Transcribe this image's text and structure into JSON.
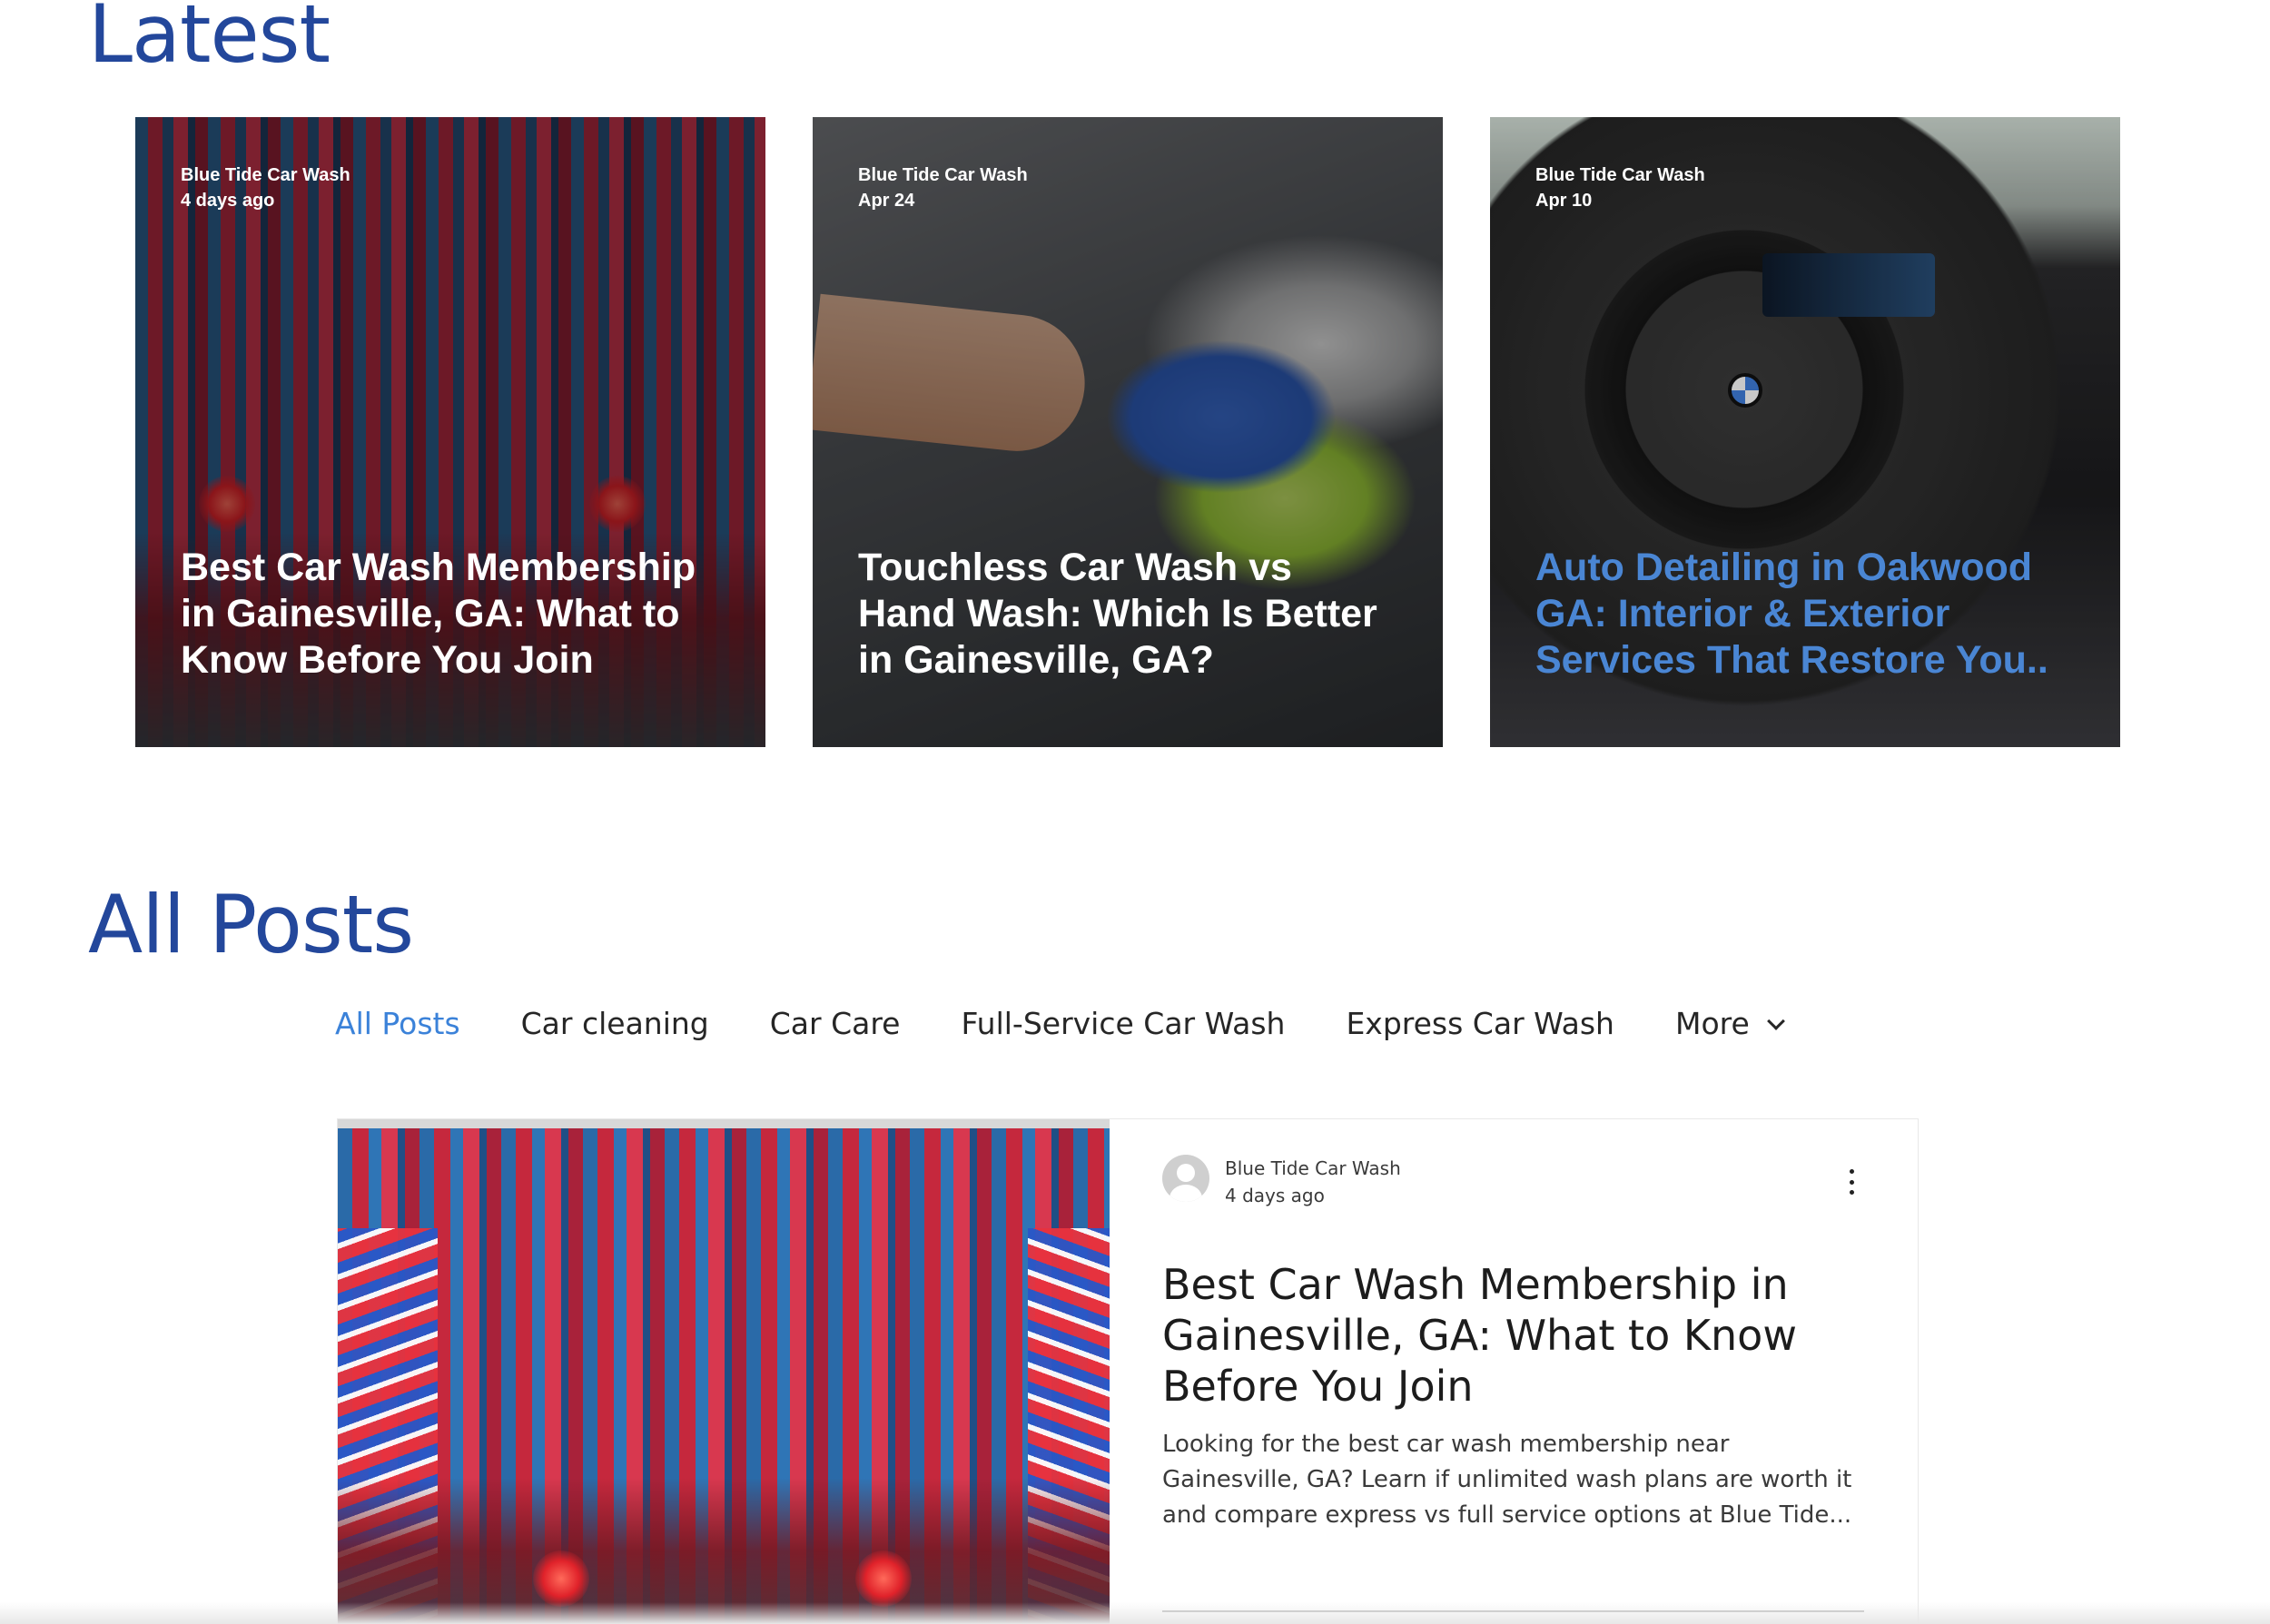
{
  "latest": {
    "heading": "Latest",
    "cards": [
      {
        "author": "Blue Tide Car Wash",
        "date": "4 days ago",
        "title": "Best Car Wash Membership in Gainesville, GA: What to Know Before You Join"
      },
      {
        "author": "Blue Tide Car Wash",
        "date": "Apr 24",
        "title": "Touchless Car Wash vs Hand Wash: Which Is Better in Gainesville, GA?"
      },
      {
        "author": "Blue Tide Car Wash",
        "date": "Apr 10",
        "title": "Auto Detailing in Oakwood GA: Interior & Exterior Services That Restore You.."
      }
    ]
  },
  "all_posts": {
    "heading": "All Posts",
    "tabs": [
      "All Posts",
      "Car cleaning",
      "Car Care",
      "Full-Service Car Wash",
      "Express Car Wash"
    ],
    "more_label": "More",
    "post": {
      "author": "Blue Tide Car Wash",
      "date": "4 days ago",
      "title": "Best Car Wash Membership in Gainesville, GA: What to Know Before You Join",
      "excerpt": "Looking for the best car wash membership near Gainesville, GA? Learn if unlimited wash plans are worth it and compare express vs full service options at Blue Tide..."
    }
  },
  "icons": {
    "more_chevron": "chevron-down-icon",
    "post_menu": "more-vertical-icon",
    "avatar": "avatar-placeholder-icon"
  },
  "colors": {
    "heading": "#23479b",
    "active_tab": "#3b82d9",
    "card_accent_title": "#4a86d4"
  }
}
